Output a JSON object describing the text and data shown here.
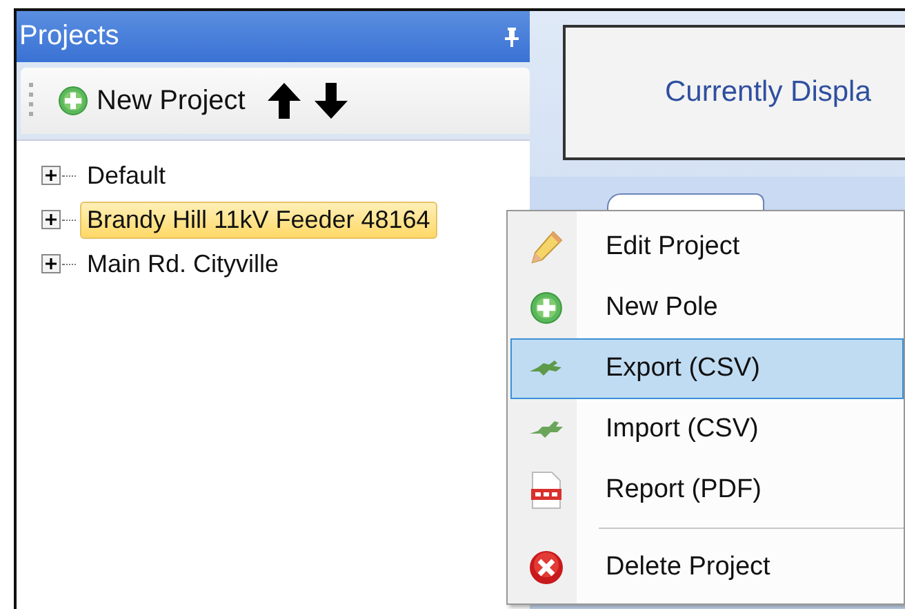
{
  "panel": {
    "title": "Projects",
    "toolbar": {
      "new_button": "New Project"
    }
  },
  "tree": [
    {
      "label": "Default",
      "expanded": false,
      "selected": false
    },
    {
      "label": "Brandy Hill 11kV Feeder 48164",
      "expanded": false,
      "selected": true
    },
    {
      "label": "Main Rd. Cityville",
      "expanded": false,
      "selected": false
    }
  ],
  "display": {
    "text": "Currently Displa"
  },
  "context_menu": [
    {
      "kind": "item",
      "label": "Edit Project",
      "selected": false
    },
    {
      "kind": "item",
      "label": "New Pole",
      "selected": false
    },
    {
      "kind": "item",
      "label": "Export (CSV)",
      "selected": true
    },
    {
      "kind": "item",
      "label": "Import (CSV)",
      "selected": false
    },
    {
      "kind": "item",
      "label": "Report (PDF)",
      "selected": false
    },
    {
      "kind": "separator"
    },
    {
      "kind": "item",
      "label": "Delete Project",
      "selected": false
    }
  ]
}
